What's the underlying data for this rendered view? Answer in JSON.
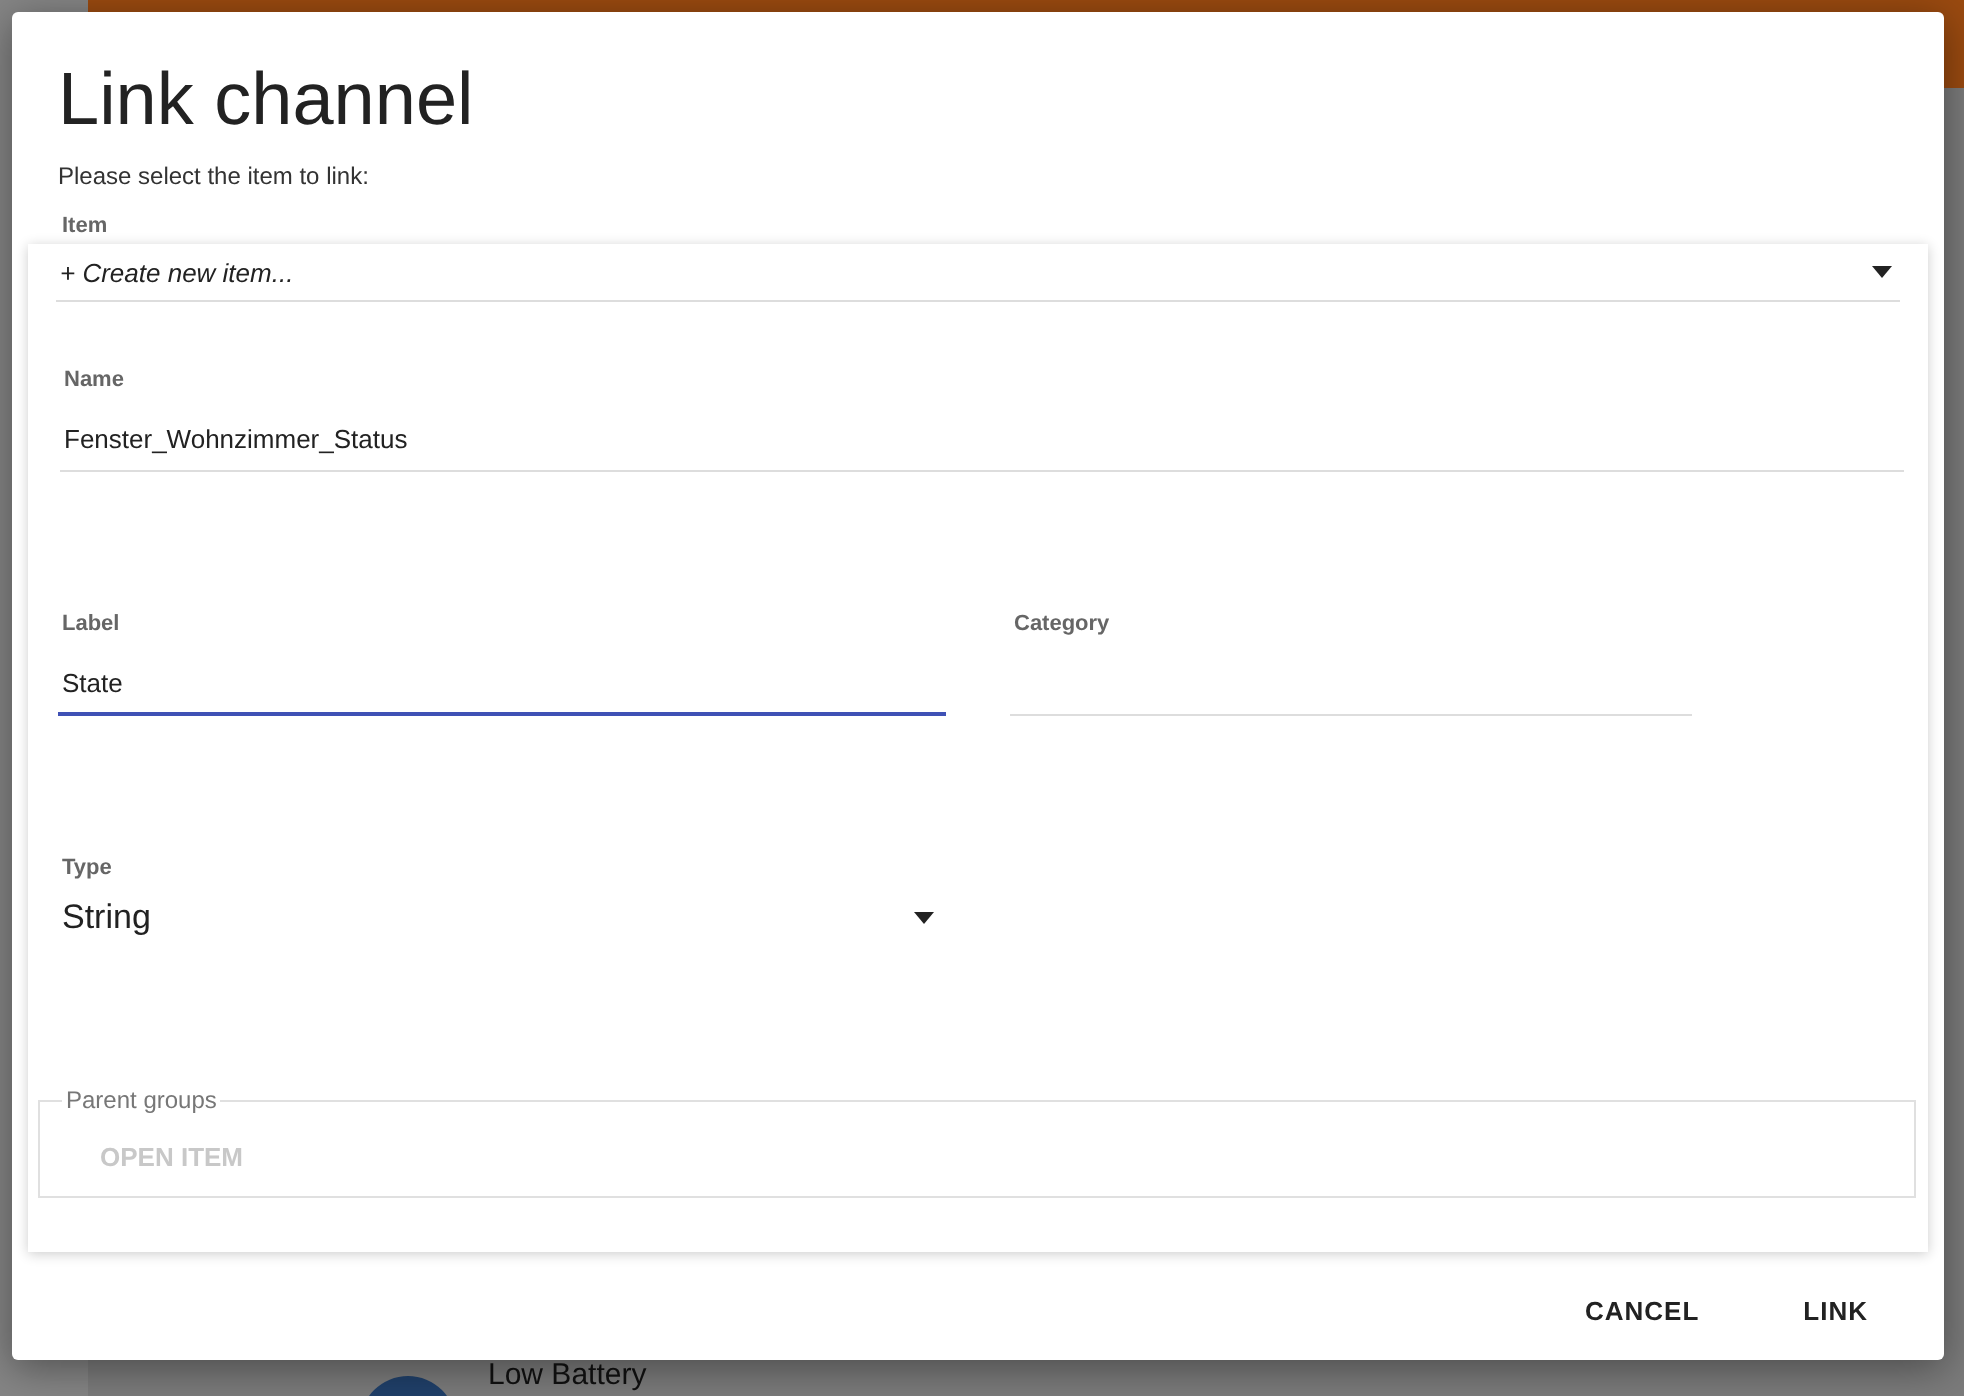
{
  "background": {
    "text": "Low Battery"
  },
  "dialog": {
    "title": "Link channel",
    "prompt": "Please select the item to link:",
    "item": {
      "label": "Item",
      "value": "+ Create new item..."
    },
    "name": {
      "label": "Name",
      "value": "Fenster_Wohnzimmer_Status",
      "focused": false
    },
    "label": {
      "label": "Label",
      "value": "State",
      "focused": true
    },
    "category": {
      "label": "Category",
      "focused": false
    },
    "type": {
      "label": "Type",
      "value": "String"
    },
    "parent_groups": {
      "legend": "Parent groups",
      "button": {
        "label": "OPEN ITEM",
        "disabled": true
      }
    },
    "buttons": [
      {
        "label": "CANCEL"
      },
      {
        "label": "LINK"
      }
    ]
  }
}
